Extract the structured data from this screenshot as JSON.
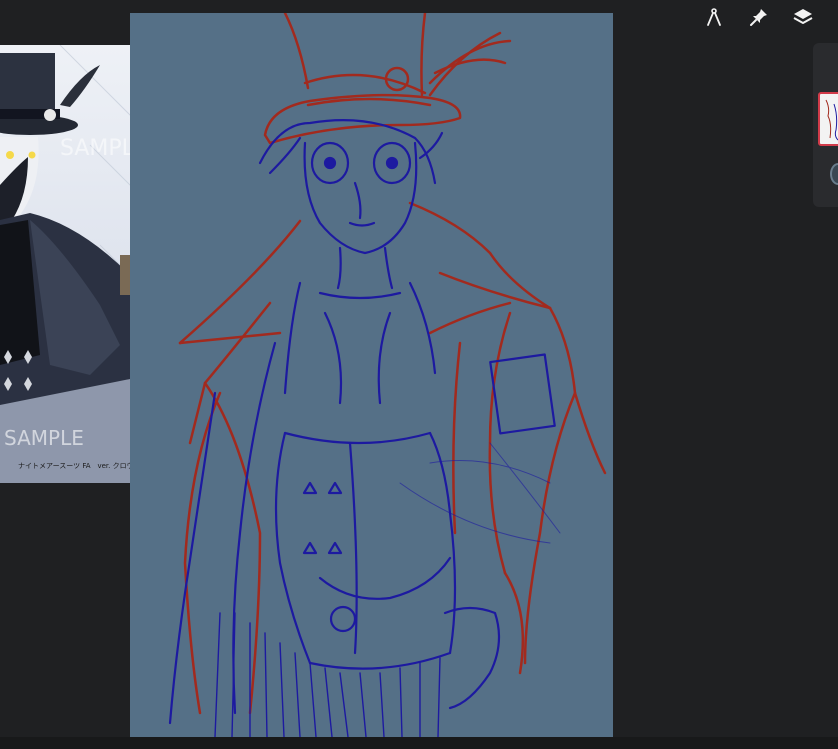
{
  "toolbar": {
    "icons": [
      "compass-icon",
      "pin-icon",
      "layers-icon"
    ]
  },
  "reference": {
    "watermark": "SAMPLE",
    "caption": "ナイトメアースーツ FA　ver. クロウリー"
  },
  "colors": {
    "canvas_bg": "#557087",
    "sketch_red": "#a22a1e",
    "sketch_blue": "#1d1aa0",
    "layer_selected": "#d23b4a",
    "app_bg": "#1f2022"
  }
}
